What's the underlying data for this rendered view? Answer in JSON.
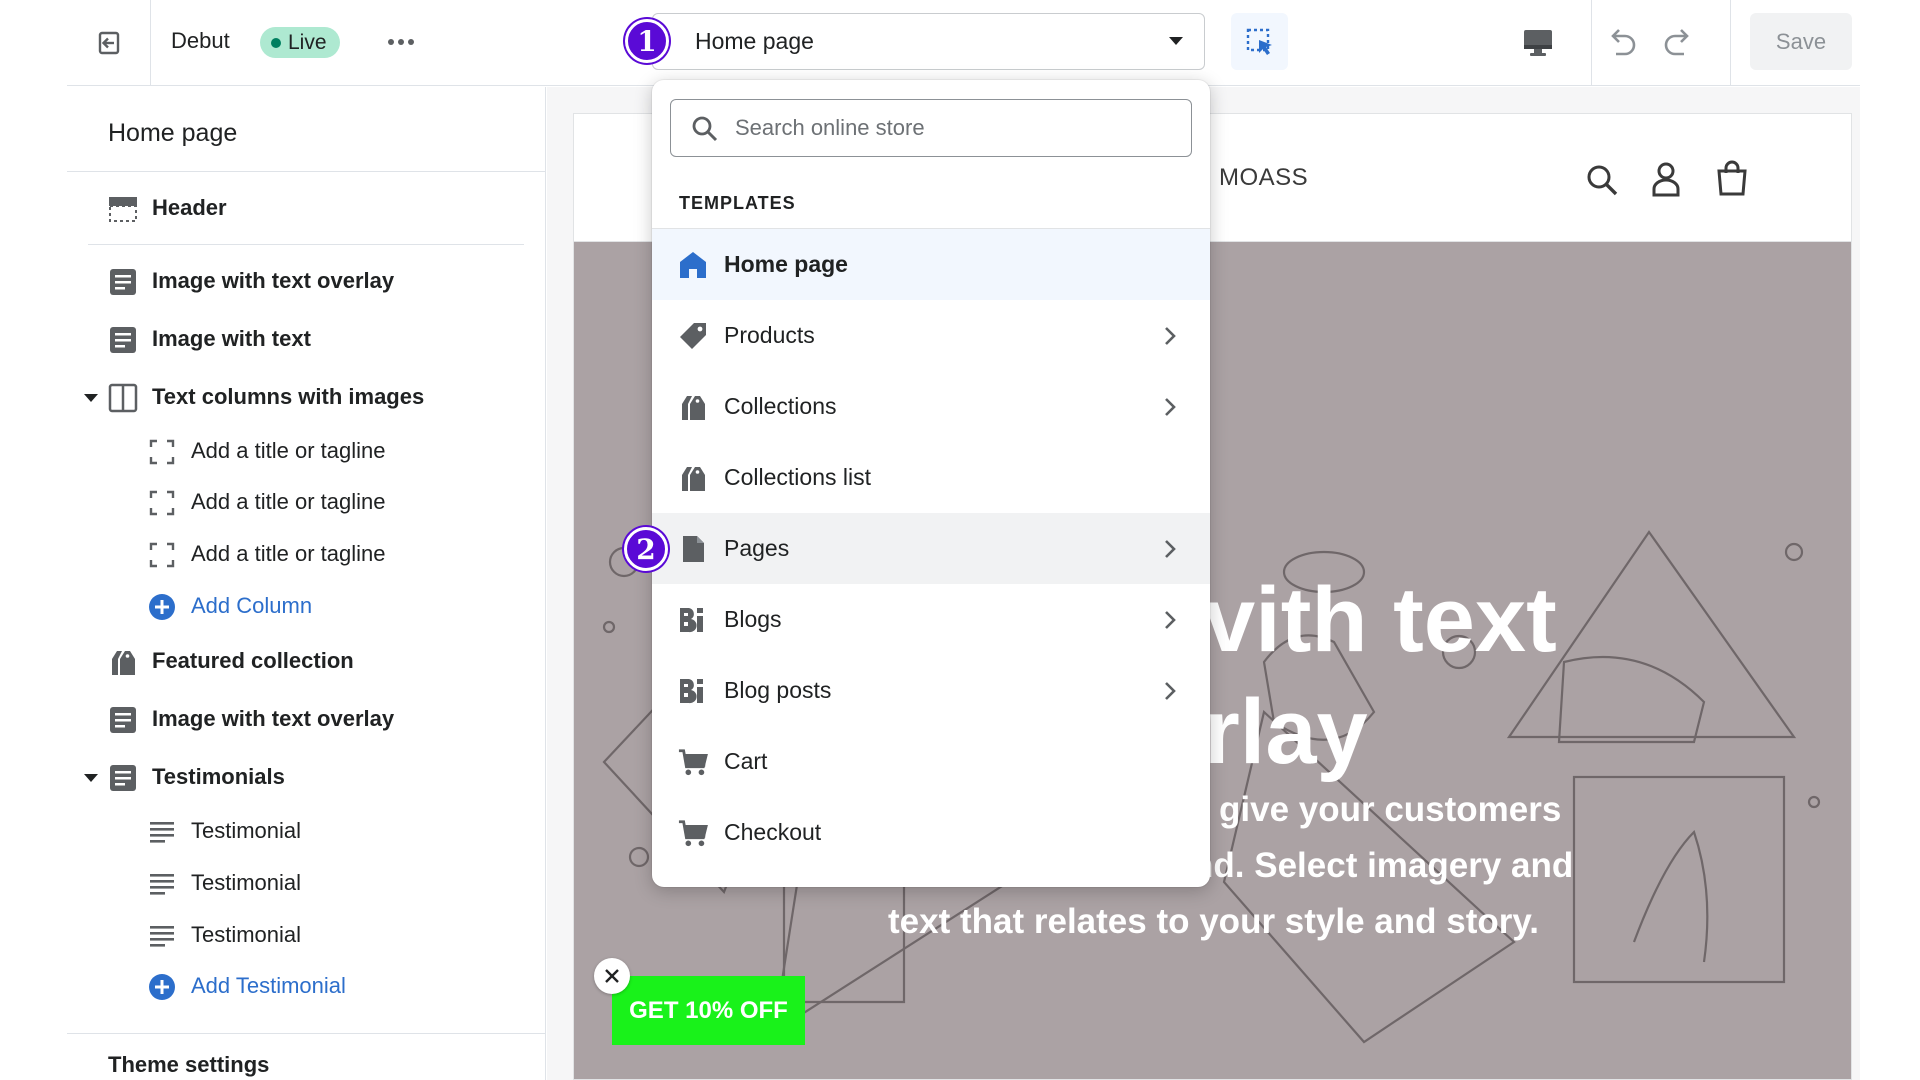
{
  "topbar": {
    "theme_name": "Debut",
    "live_label": "Live",
    "template_selected": "Home page",
    "save_label": "Save"
  },
  "steps": {
    "one": "1",
    "two": "2"
  },
  "sidebar": {
    "title": "Home page",
    "header_label": "Header",
    "items": [
      {
        "label": "Image with text overlay"
      },
      {
        "label": "Image with text"
      },
      {
        "label": "Text columns with images"
      },
      {
        "label": "Add a title or tagline"
      },
      {
        "label": "Add a title or tagline"
      },
      {
        "label": "Add a title or tagline"
      },
      {
        "label": "Add Column"
      },
      {
        "label": "Featured collection"
      },
      {
        "label": "Image with text overlay"
      },
      {
        "label": "Testimonials"
      },
      {
        "label": "Testimonial"
      },
      {
        "label": "Testimonial"
      },
      {
        "label": "Testimonial"
      },
      {
        "label": "Add Testimonial"
      }
    ],
    "theme_settings": "Theme settings"
  },
  "dropdown": {
    "search_placeholder": "Search online store",
    "heading": "TEMPLATES",
    "items": [
      {
        "label": "Home page",
        "icon": "home-icon",
        "has_submenu": false,
        "state": "selected"
      },
      {
        "label": "Products",
        "icon": "tag-icon",
        "has_submenu": true
      },
      {
        "label": "Collections",
        "icon": "collection-icon",
        "has_submenu": true
      },
      {
        "label": "Collections list",
        "icon": "collection-icon",
        "has_submenu": false
      },
      {
        "label": "Pages",
        "icon": "page-icon",
        "has_submenu": true,
        "state": "hover"
      },
      {
        "label": "Blogs",
        "icon": "blog-icon",
        "has_submenu": true
      },
      {
        "label": "Blog posts",
        "icon": "blog-icon",
        "has_submenu": true
      },
      {
        "label": "Cart",
        "icon": "cart-icon",
        "has_submenu": false
      },
      {
        "label": "Checkout",
        "icon": "cart-icon",
        "has_submenu": false
      }
    ]
  },
  "preview": {
    "store_name": "MOASS",
    "hero_title_line1": "vith text",
    "hero_title_line2": "rlay",
    "hero_text_line1": "give your customers",
    "hero_text_line2": "insight into your brand. Select imagery and",
    "hero_text_line3": "text that relates to your style and story.",
    "promo_label": "GET 10% OFF"
  },
  "colors": {
    "accent": "#2c6ecb",
    "step_badge": "#5a0ad6",
    "live_badge": "#aee9d1",
    "promo": "#19f21a",
    "hero_bg": "#aba2a4"
  }
}
